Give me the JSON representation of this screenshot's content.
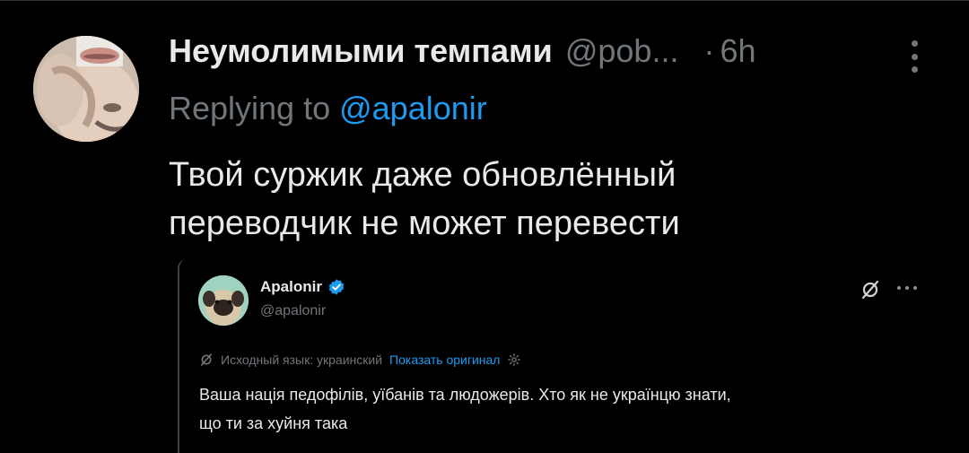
{
  "tweet": {
    "display_name": "Неумолимыми темпами",
    "handle": "@pob...",
    "separator": "·",
    "time": "6h",
    "replying_prefix": "Replying to ",
    "replying_to": "@apalonir",
    "text_line1": "Твой суржик даже обновлённый",
    "text_line2": "переводчик не может перевести"
  },
  "quote": {
    "display_name": "Apalonir",
    "handle": "@apalonir",
    "source_language": "Исходный язык: украинский",
    "show_original": "Показать оригинал",
    "text_line1": "Ваша нація педофілів, уїбанів та людожерів. Хто як не українцю знати,",
    "text_line2": "що ти за хуйня така"
  },
  "colors": {
    "background": "#000000",
    "primary_text": "#e7e9ea",
    "secondary_text": "#71767b",
    "accent": "#1d9bf0"
  },
  "icons": {
    "more": "more-vertical-icon",
    "quote_more": "more-horizontal-icon",
    "translate": "translate-slash-icon",
    "verified": "verified-badge-icon",
    "settings": "settings-gear-icon"
  }
}
